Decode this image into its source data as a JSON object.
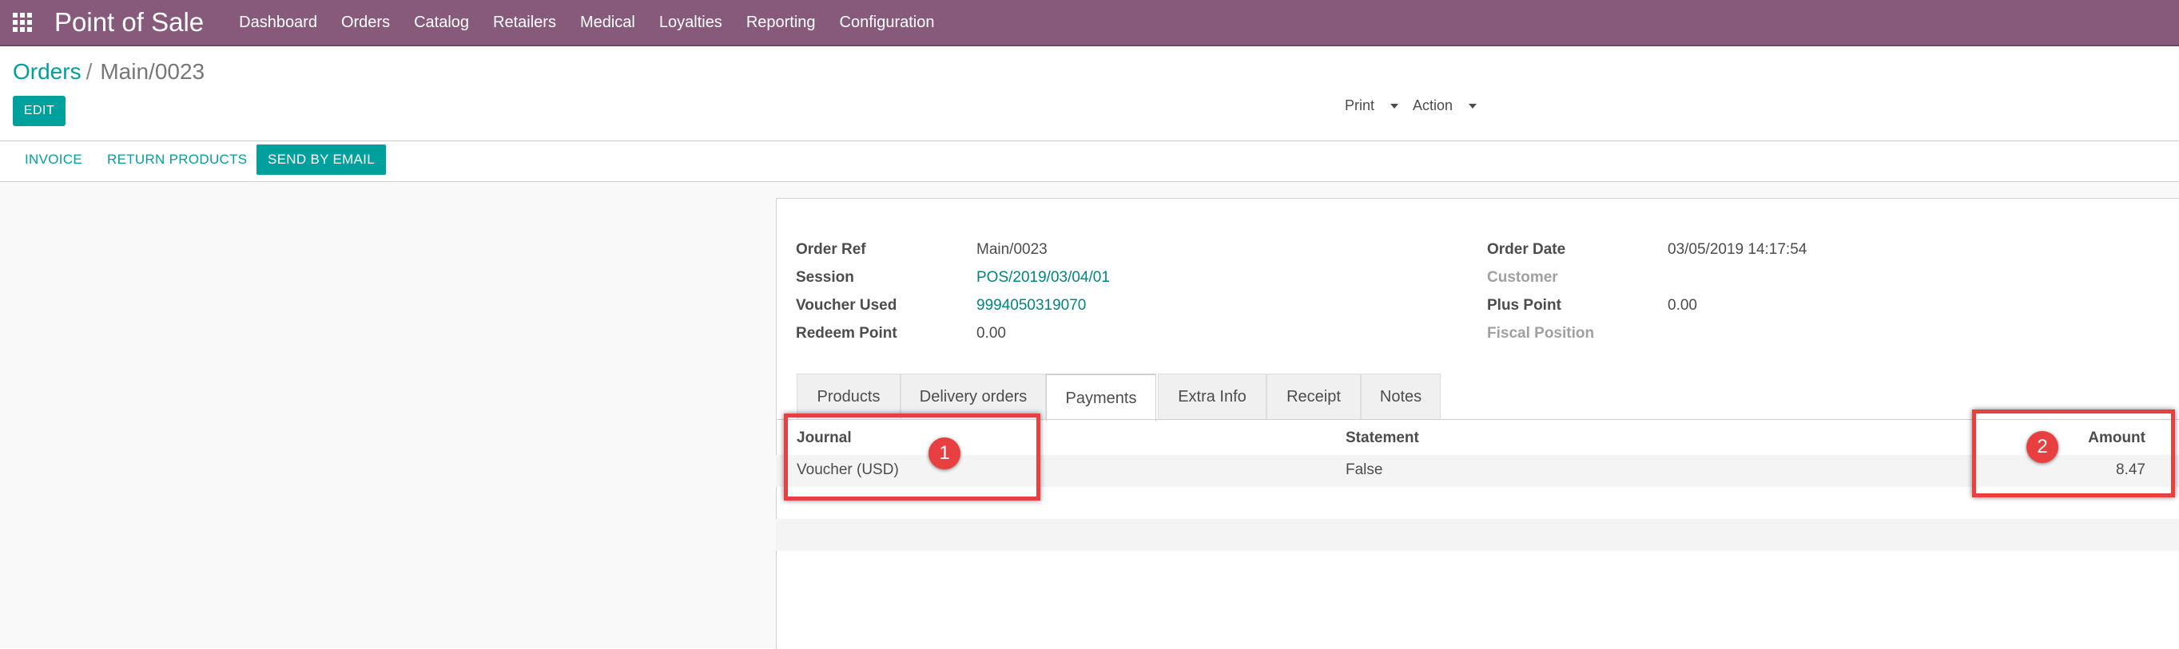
{
  "app": {
    "title": "Point of Sale",
    "menu": [
      "Dashboard",
      "Orders",
      "Catalog",
      "Retailers",
      "Medical",
      "Loyalties",
      "Reporting",
      "Configuration"
    ]
  },
  "breadcrumb": {
    "parent": "Orders",
    "separator": "/",
    "current": "Main/0023"
  },
  "toolbar": {
    "edit_label": "EDIT",
    "print_label": "Print",
    "action_label": "Action"
  },
  "statusbar": {
    "invoice": "INVOICE",
    "return_products": "RETURN PRODUCTS",
    "send_by_email": "SEND BY EMAIL"
  },
  "order": {
    "order_ref_label": "Order Ref",
    "order_ref": "Main/0023",
    "session_label": "Session",
    "session": "POS/2019/03/04/01",
    "voucher_used_label": "Voucher Used",
    "voucher_used": "9994050319070",
    "redeem_point_label": "Redeem Point",
    "redeem_point": "0.00",
    "order_date_label": "Order Date",
    "order_date": "03/05/2019 14:17:54",
    "customer_label": "Customer",
    "plus_point_label": "Plus Point",
    "plus_point": "0.00",
    "fiscal_position_label": "Fiscal Position"
  },
  "tabs": [
    "Products",
    "Delivery orders",
    "Payments",
    "Extra Info",
    "Receipt",
    "Notes"
  ],
  "active_tab": "Payments",
  "payments": {
    "headers": {
      "journal": "Journal",
      "statement": "Statement",
      "amount": "Amount"
    },
    "rows": [
      {
        "journal": "Voucher (USD)",
        "statement": "False",
        "amount": "8.47"
      }
    ]
  },
  "annotations": {
    "badge1": "1",
    "badge2": "2"
  },
  "colors": {
    "brand": "#875a7b",
    "accent": "#00a09d",
    "annotation": "#e84040"
  }
}
